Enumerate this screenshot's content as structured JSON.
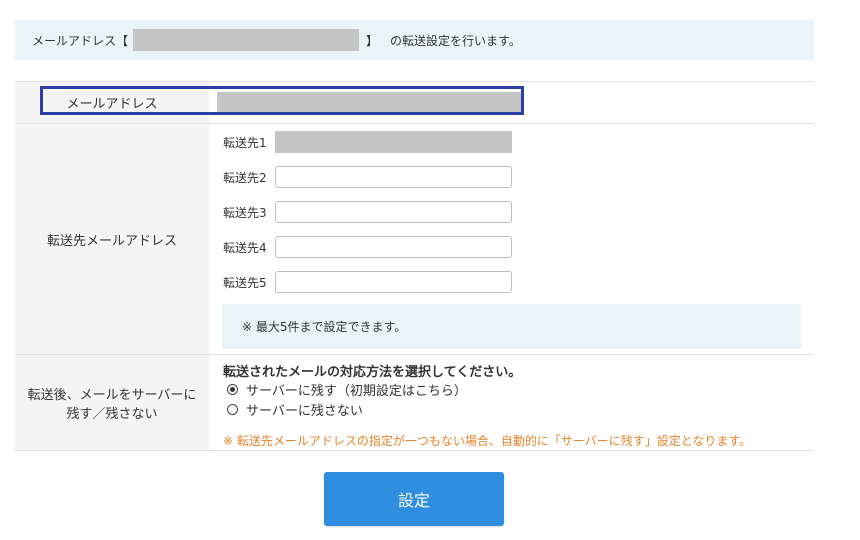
{
  "notice": {
    "prefix": "メールアドレス【",
    "suffix_bracket": "】",
    "suffix_text": "の転送設定を行います。"
  },
  "email_row": {
    "label": "メールアドレス"
  },
  "forward_row": {
    "label": "転送先メールアドレス",
    "items": [
      {
        "label": "転送先1"
      },
      {
        "label": "転送先2"
      },
      {
        "label": "転送先3"
      },
      {
        "label": "転送先4"
      },
      {
        "label": "転送先5"
      }
    ],
    "info": "※ 最大5件まで設定できます。"
  },
  "keep_row": {
    "label_line1": "転送後、メールをサーバーに",
    "label_line2": "残す／残さない",
    "title": "転送されたメールの対応方法を選択してください。",
    "options": [
      {
        "label": "サーバーに残す（初期設定はこちら）",
        "checked": true
      },
      {
        "label": "サーバーに残さない",
        "checked": false
      }
    ],
    "note": "※ 転送先メールアドレスの指定が一つもない場合、自動的に「サーバーに残す」設定となります。"
  },
  "submit": {
    "label": "設定"
  },
  "colors": {
    "accent": "#2f8ee0",
    "highlight_border": "#2e3fa8",
    "warning_text": "#e8852a",
    "info_bg": "#e8f4f5"
  }
}
